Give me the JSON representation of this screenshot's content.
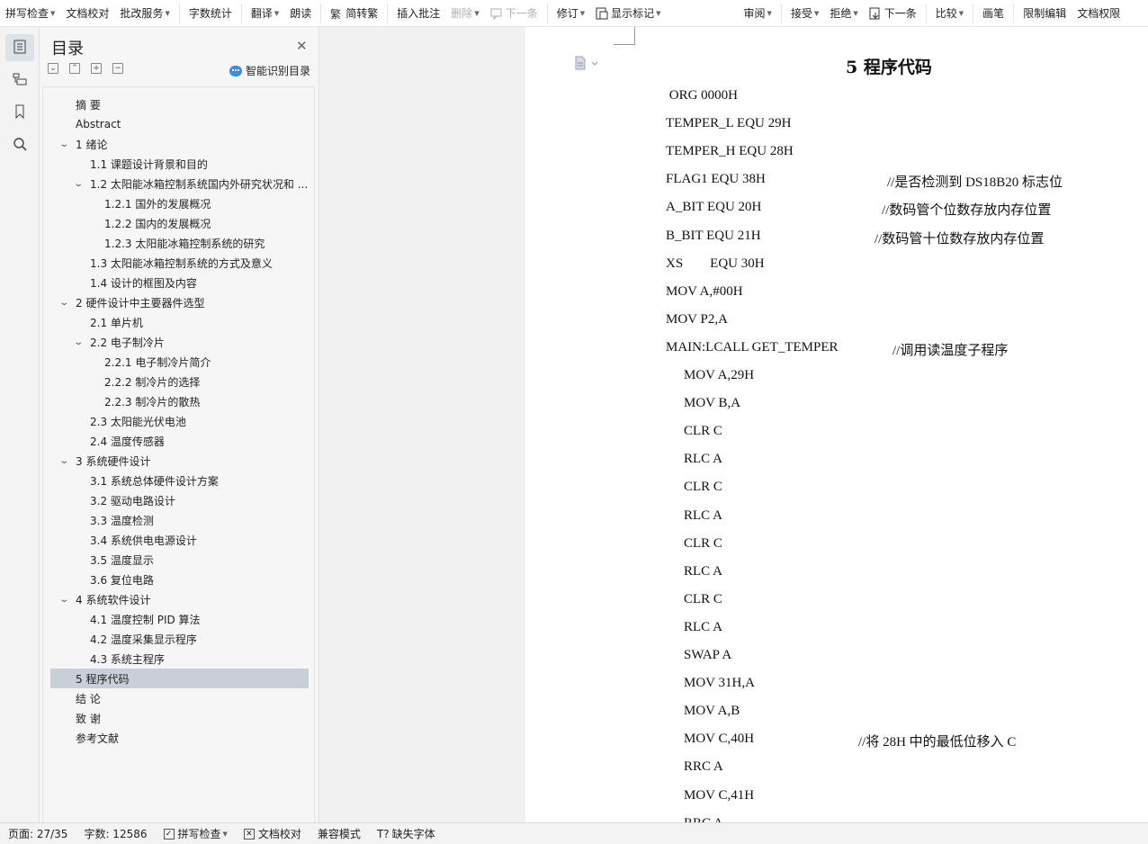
{
  "toolbar": {
    "spell_check": "拼写检查",
    "doc_proofread": "文档校对",
    "batch_service": "批改服务",
    "word_count": "字数统计",
    "translate": "翻译",
    "read_aloud": "朗读",
    "simp_trad": "简转繁",
    "insert_comment": "插入批注",
    "delete": "删除",
    "next": "下一条",
    "revise": "修订",
    "show_markup": "显示标记",
    "review": "审阅",
    "accept": "接受",
    "reject": "拒绝",
    "next2": "下一条",
    "compare": "比较",
    "pen": "画笔",
    "restrict_edit": "限制编辑",
    "doc_permission": "文档权限"
  },
  "toc": {
    "title": "目录",
    "smart_label": "智能识别目录",
    "items": [
      {
        "label": "摘    要",
        "level": 0,
        "chev": false
      },
      {
        "label": "Abstract",
        "level": 0,
        "chev": false
      },
      {
        "label": "1  绪论",
        "level": 0,
        "chev": true
      },
      {
        "label": "1.1 课题设计背景和目的",
        "level": 1,
        "chev": false
      },
      {
        "label": "1.2  太阳能冰箱控制系统国内外研究状况和 ...",
        "level": 1,
        "chev": true
      },
      {
        "label": "1.2.1 国外的发展概况",
        "level": 2,
        "chev": false
      },
      {
        "label": "1.2.2  国内的发展概况",
        "level": 2,
        "chev": false
      },
      {
        "label": "1.2.3  太阳能冰箱控制系统的研究",
        "level": 2,
        "chev": false
      },
      {
        "label": "1.3 太阳能冰箱控制系统的方式及意义",
        "level": 1,
        "chev": false
      },
      {
        "label": "1.4 设计的框图及内容",
        "level": 1,
        "chev": false
      },
      {
        "label": "2  硬件设计中主要器件选型",
        "level": 0,
        "chev": true
      },
      {
        "label": "2.1 单片机",
        "level": 1,
        "chev": false
      },
      {
        "label": "2.2  电子制冷片",
        "level": 1,
        "chev": true
      },
      {
        "label": "2.2.1  电子制冷片简介",
        "level": 2,
        "chev": false
      },
      {
        "label": "2.2.2  制冷片的选择",
        "level": 2,
        "chev": false
      },
      {
        "label": "2.2.3  制冷片的散热",
        "level": 2,
        "chev": false
      },
      {
        "label": "2.3  太阳能光伏电池",
        "level": 1,
        "chev": false
      },
      {
        "label": "2.4  温度传感器",
        "level": 1,
        "chev": false
      },
      {
        "label": "3  系统硬件设计",
        "level": 0,
        "chev": true
      },
      {
        "label": "3.1 系统总体硬件设计方案",
        "level": 1,
        "chev": false
      },
      {
        "label": "3.2  驱动电路设计",
        "level": 1,
        "chev": false
      },
      {
        "label": "3.3  温度检测",
        "level": 1,
        "chev": false
      },
      {
        "label": "3.4  系统供电电源设计",
        "level": 1,
        "chev": false
      },
      {
        "label": "3.5  温度显示",
        "level": 1,
        "chev": false
      },
      {
        "label": "3.6  复位电路",
        "level": 1,
        "chev": false
      },
      {
        "label": "4  系统软件设计",
        "level": 0,
        "chev": true
      },
      {
        "label": "4.1  温度控制 PID 算法",
        "level": 1,
        "chev": false
      },
      {
        "label": "4.2  温度采集显示程序",
        "level": 1,
        "chev": false
      },
      {
        "label": "4.3  系统主程序",
        "level": 1,
        "chev": false
      },
      {
        "label": "5  程序代码",
        "level": 0,
        "chev": false,
        "selected": true
      },
      {
        "label": "结    论",
        "level": 0,
        "chev": false
      },
      {
        "label": "致    谢",
        "level": 0,
        "chev": false
      },
      {
        "label": "参考文献",
        "level": 0,
        "chev": false
      }
    ]
  },
  "document": {
    "title": "5  程序代码",
    "lines": [
      {
        "code": " ORG 0000H",
        "indent": 0,
        "comment": ""
      },
      {
        "code": "TEMPER_L EQU 29H",
        "indent": 0,
        "comment": ""
      },
      {
        "code": "TEMPER_H EQU 28H",
        "indent": 0,
        "comment": ""
      },
      {
        "code": "FLAG1 EQU 38H",
        "indent": 0,
        "comment": "//是否检测到 DS18B20 标志位"
      },
      {
        "code": "A_BIT EQU 20H",
        "indent": 0,
        "comment": "//数码管个位数存放内存位置"
      },
      {
        "code": "B_BIT EQU 21H",
        "indent": 0,
        "comment": "//数码管十位数存放内存位置"
      },
      {
        "code": "XS        EQU 30H",
        "indent": 0,
        "comment": ""
      },
      {
        "code": "MOV A,#00H",
        "indent": 0,
        "comment": ""
      },
      {
        "code": "MOV P2,A",
        "indent": 0,
        "comment": ""
      },
      {
        "code": "MAIN:LCALL GET_TEMPER",
        "indent": 0,
        "comment": "//调用读温度子程序"
      },
      {
        "code": "MOV A,29H",
        "indent": 1,
        "comment": ""
      },
      {
        "code": "MOV B,A",
        "indent": 1,
        "comment": ""
      },
      {
        "code": "CLR C",
        "indent": 1,
        "comment": ""
      },
      {
        "code": "RLC A",
        "indent": 1,
        "comment": ""
      },
      {
        "code": "CLR C",
        "indent": 1,
        "comment": ""
      },
      {
        "code": "RLC A",
        "indent": 1,
        "comment": ""
      },
      {
        "code": "CLR C",
        "indent": 1,
        "comment": ""
      },
      {
        "code": "RLC A",
        "indent": 1,
        "comment": ""
      },
      {
        "code": "CLR C",
        "indent": 1,
        "comment": ""
      },
      {
        "code": "RLC A",
        "indent": 1,
        "comment": ""
      },
      {
        "code": "SWAP A",
        "indent": 1,
        "comment": ""
      },
      {
        "code": "MOV 31H,A",
        "indent": 1,
        "comment": ""
      },
      {
        "code": "MOV A,B",
        "indent": 1,
        "comment": ""
      },
      {
        "code": "MOV C,40H",
        "indent": 1,
        "comment": "//将 28H 中的最低位移入 C"
      },
      {
        "code": "RRC A",
        "indent": 1,
        "comment": ""
      },
      {
        "code": "MOV C,41H",
        "indent": 1,
        "comment": ""
      },
      {
        "code": "RRC A",
        "indent": 1,
        "comment": ""
      }
    ]
  },
  "status": {
    "page": "页面: 27/35",
    "words": "字数: 12586",
    "spell_check": "拼写检查",
    "doc_proofread": "文档校对",
    "compat_mode": "兼容模式",
    "missing_font": "缺失字体"
  }
}
